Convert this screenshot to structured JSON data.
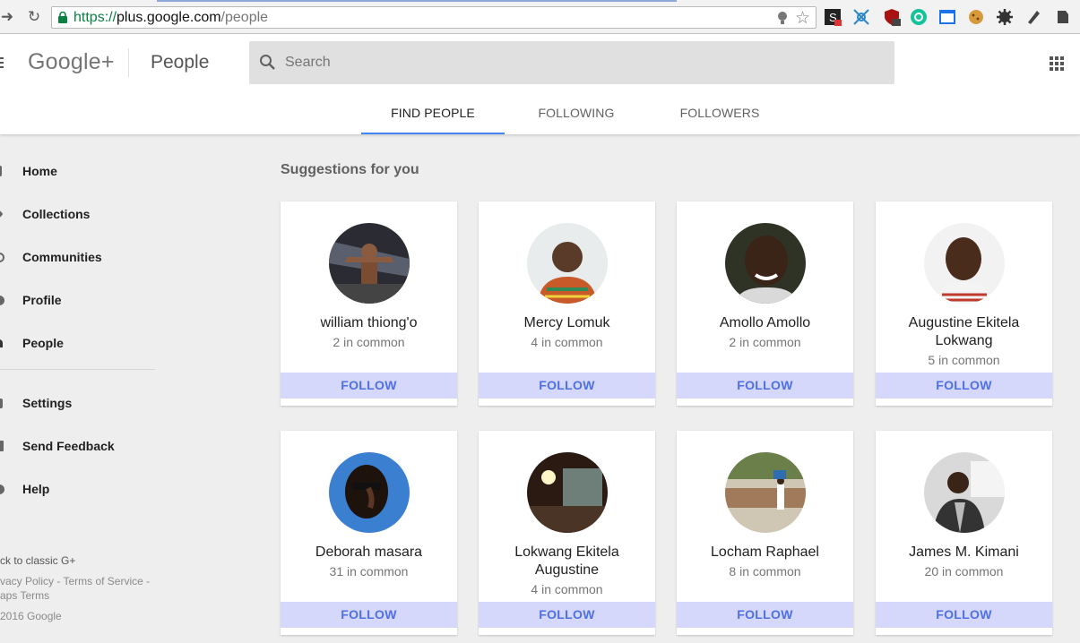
{
  "browser": {
    "url_scheme": "https://",
    "url_host": "plus.google.com",
    "url_path": "/people"
  },
  "header": {
    "logo": "Google+",
    "page_title": "People",
    "search_placeholder": "Search",
    "tabs": [
      {
        "label": "FIND PEOPLE",
        "active": true
      },
      {
        "label": "FOLLOWING",
        "active": false
      },
      {
        "label": "FOLLOWERS",
        "active": false
      }
    ]
  },
  "sidebar": {
    "items": [
      {
        "label": "Home",
        "icon": "home-icon"
      },
      {
        "label": "Collections",
        "icon": "collections-icon"
      },
      {
        "label": "Communities",
        "icon": "communities-icon"
      },
      {
        "label": "Profile",
        "icon": "profile-icon"
      },
      {
        "label": "People",
        "icon": "people-icon"
      }
    ],
    "secondary": [
      {
        "label": "Settings",
        "icon": "settings-icon"
      },
      {
        "label": "Send Feedback",
        "icon": "feedback-icon"
      },
      {
        "label": "Help",
        "icon": "help-icon"
      }
    ],
    "footer": {
      "classic": "ck to classic G+",
      "links_1": "vacy Policy - Terms of Service -",
      "links_2": "aps Terms",
      "copyright": "2016 Google"
    }
  },
  "main": {
    "title": "Suggestions for you",
    "follow_label": "FOLLOW",
    "people": [
      {
        "name": "william thiong'o",
        "common": "2 in common"
      },
      {
        "name": "Mercy Lomuk",
        "common": "4 in common"
      },
      {
        "name": "Amollo Amollo",
        "common": "2 in common"
      },
      {
        "name": "Augustine Ekitela Lokwang",
        "common": "5 in common"
      },
      {
        "name": "Deborah masara",
        "common": "31 in common"
      },
      {
        "name": "Lokwang Ekitela Augustine",
        "common": "4 in common"
      },
      {
        "name": "Locham Raphael",
        "common": "8 in common"
      },
      {
        "name": "James M. Kimani",
        "common": "20 in common"
      }
    ]
  },
  "colors": {
    "accent": "#4285f4",
    "follow_bg": "#d5d8fb",
    "follow_text": "#4e70e3"
  }
}
